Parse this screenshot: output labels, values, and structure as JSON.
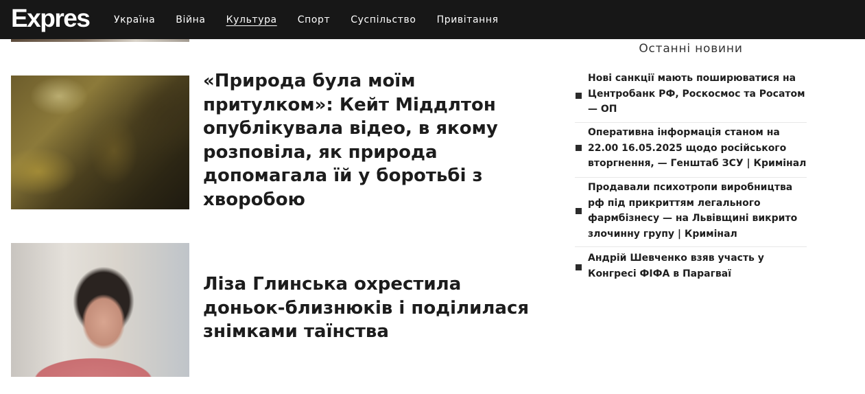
{
  "header": {
    "logo": "Expres",
    "nav": [
      {
        "label": "Україна"
      },
      {
        "label": "Війна"
      },
      {
        "label": "Культура"
      },
      {
        "label": "Спорт"
      },
      {
        "label": "Суспільство"
      },
      {
        "label": "Привітання"
      }
    ],
    "active_nav": "Культура"
  },
  "articles": [
    {
      "headline": "«Природа була моїм притулком»: Кейт Міддлтон опублікувала відео, в якому розповіла, як природа допомагала їй у боротьбі з хворобою"
    },
    {
      "headline": "Ліза Глинська охрестила доньок-близнюків і поділилася знімками таїнства"
    }
  ],
  "sidebar": {
    "title": "Останні новини",
    "items": [
      {
        "text": "Нові санкції мають поширюватися на Центробанк РФ, Роскосмос та Росатом — ОП"
      },
      {
        "text": "Оперативна інформація станом на 22.00 16.05.2025 щодо російського вторгнення, — Генштаб ЗСУ | Кримінал"
      },
      {
        "text": "Продавали психотропи виробництва рф під прикриттям легального фармбізнесу — на Львівщині викрито злочинну групу | Кримінал"
      },
      {
        "text": "Андрій Шевченко взяв участь у Конгресі ФІФА в Парагваї"
      }
    ]
  },
  "colors": {
    "header_bg": "#171717",
    "text": "#1c1c1c",
    "bullet": "#2b2b2b"
  }
}
